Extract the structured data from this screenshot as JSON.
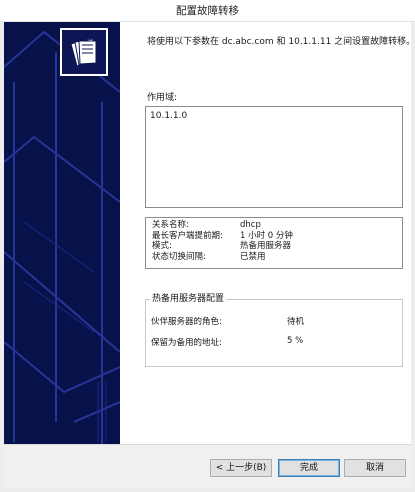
{
  "window": {
    "title": "配置故障转移"
  },
  "intro_text": "将使用以下参数在 dc.abc.com 和 10.1.1.11 之间设置故障转移。",
  "scope": {
    "label": "作用域:",
    "items": [
      "10.1.1.0"
    ]
  },
  "relationship": {
    "rows": [
      {
        "key": "关系名称:",
        "value": "dhcp"
      },
      {
        "key": "最长客户端提前期:",
        "value": "1 小时 0 分钟"
      },
      {
        "key": "模式:",
        "value": "热备用服务器"
      },
      {
        "key": "状态切换间隔:",
        "value": "已禁用"
      }
    ]
  },
  "hot_standby": {
    "title": "热备用服务器配置",
    "partner_role_label": "伙伴服务器的角色:",
    "partner_role_value": "待机",
    "reserve_label": "保留为备用的地址:",
    "reserve_value": "5 %"
  },
  "buttons": {
    "back": "< 上一步(B)",
    "finish": "完成",
    "cancel": "取消"
  },
  "colors": {
    "banner": "#07124a",
    "footer": "#f0f0f0"
  },
  "icons": {
    "banner_icon": "folders-icon"
  }
}
